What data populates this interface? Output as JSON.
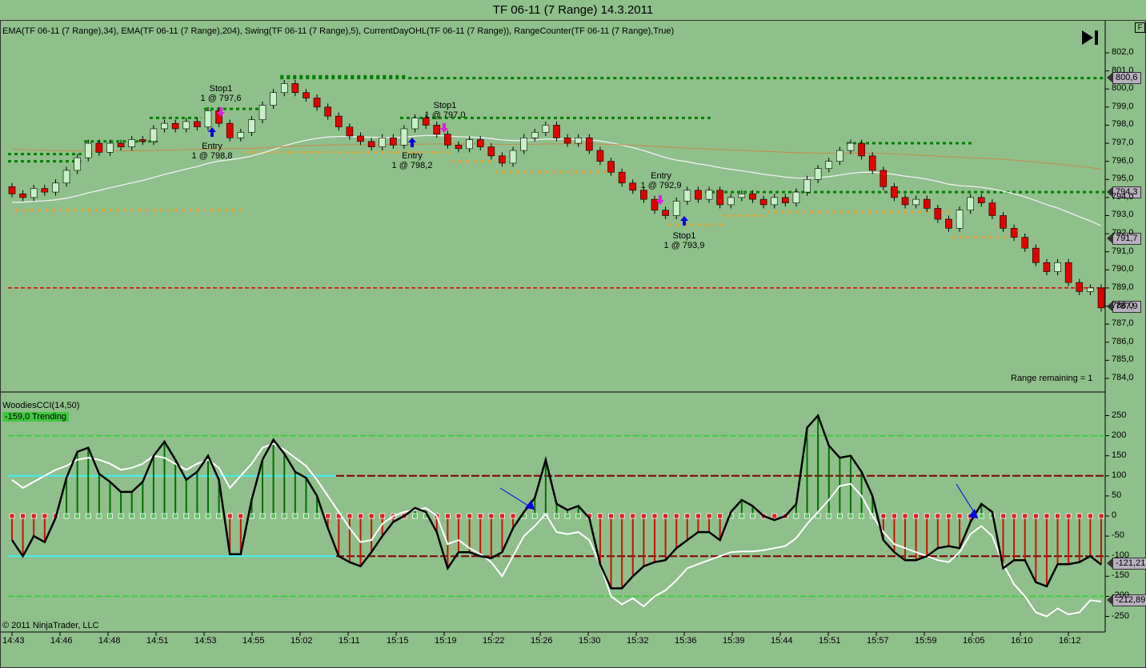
{
  "title": "TF 06-11 (7 Range)  14.3.2011",
  "indicators_label": "EMA(TF 06-11 (7 Range),34), EMA(TF 06-11 (7 Range),204), Swing(TF 06-11 (7 Range),5), CurrentDayOHL(TF 06-11 (7 Range)), RangeCounter(TF 06-11 (7 Range),True)",
  "f_button": "F",
  "range_remaining": "Range remaining = 1",
  "copyright": "© 2011 NinjaTrader, LLC",
  "cci_label": "WoodiesCCI(14,50)",
  "cci_status": "-159,0 Trending",
  "price_labels": {
    "ema204": "800,6",
    "swing": "794,3",
    "ema34": "791,7",
    "last": "787,9"
  },
  "cci_labels": {
    "cci": "-121,21",
    "turbo": "-212,89"
  },
  "annotations": [
    {
      "title": "Stop1",
      "text": "1 @ 797,6"
    },
    {
      "title": "Entry",
      "text": "1 @ 798,8"
    },
    {
      "title": "Stop1",
      "text": "1 @ 797,0"
    },
    {
      "title": "Entry",
      "text": "1 @ 798,2"
    },
    {
      "title": "Entry",
      "text": "1 @ 792,9"
    },
    {
      "title": "Stop1",
      "text": "1 @ 793,9"
    }
  ],
  "chart_data": {
    "type": "candlestick",
    "price_axis": {
      "min": 784,
      "max": 802,
      "step": 1,
      "ticks": [
        "802,0",
        "801,0",
        "800,0",
        "799,0",
        "798,0",
        "797,0",
        "796,0",
        "795,0",
        "794,0",
        "793,0",
        "792,0",
        "791,0",
        "790,0",
        "789,0",
        "788,0",
        "787,0",
        "786,0",
        "785,0",
        "784,0"
      ]
    },
    "time_ticks": [
      "14:43",
      "14:46",
      "14:48",
      "14:51",
      "14:53",
      "14:55",
      "15:02",
      "15:11",
      "15:15",
      "15:19",
      "15:22",
      "15:26",
      "15:30",
      "15:32",
      "15:36",
      "15:39",
      "15:44",
      "15:51",
      "15:57",
      "15:59",
      "16:05",
      "16:10",
      "16:12"
    ],
    "first_open": 794.6,
    "closes": [
      794.2,
      794.0,
      794.5,
      794.3,
      794.8,
      795.5,
      796.2,
      797.0,
      796.5,
      797.0,
      796.8,
      797.2,
      797.1,
      797.8,
      798.1,
      797.8,
      798.2,
      797.9,
      798.8,
      798.1,
      797.3,
      797.6,
      798.3,
      799.1,
      799.8,
      800.3,
      799.8,
      799.5,
      799.0,
      798.5,
      797.9,
      797.4,
      797.1,
      796.8,
      797.3,
      796.9,
      797.8,
      798.4,
      798.0,
      797.5,
      796.9,
      796.7,
      797.2,
      796.8,
      796.3,
      795.9,
      796.6,
      797.3,
      797.6,
      798.0,
      797.3,
      797.0,
      797.3,
      796.6,
      796.0,
      795.4,
      794.8,
      794.4,
      793.9,
      793.3,
      793.0,
      793.8,
      794.4,
      793.9,
      794.4,
      793.6,
      794.0,
      794.2,
      793.9,
      793.6,
      794.0,
      793.7,
      794.3,
      795.0,
      795.6,
      796.0,
      796.6,
      797.0,
      796.3,
      795.5,
      794.6,
      794.0,
      793.6,
      793.9,
      793.4,
      792.8,
      792.3,
      793.3,
      794.0,
      793.7,
      793.0,
      792.3,
      791.8,
      791.2,
      790.4,
      789.9,
      790.4,
      789.3,
      788.8,
      789.0,
      787.9
    ],
    "ema_periods": [
      34,
      204
    ],
    "current_day_low": 789.0,
    "swing_highs": [
      {
        "price": 796.4,
        "from": 0,
        "to": 7
      },
      {
        "price": 796.0,
        "from": 0,
        "to": 6
      },
      {
        "price": 797.1,
        "from": 7,
        "to": 13
      },
      {
        "price": 798.4,
        "from": 13,
        "to": 17
      },
      {
        "price": 798.9,
        "from": 18,
        "to": 23
      },
      {
        "price": 800.7,
        "from": 25,
        "to": 36
      },
      {
        "price": 800.6,
        "from": 25,
        "to": 100
      },
      {
        "price": 798.4,
        "from": 36,
        "to": 64
      },
      {
        "price": 797.0,
        "from": 77,
        "to": 88
      },
      {
        "price": 794.3,
        "from": 64,
        "to": 100
      }
    ],
    "swing_lows": [
      {
        "price": 793.3,
        "from": 0,
        "to": 21
      },
      {
        "price": 796.5,
        "from": 21,
        "to": 40
      },
      {
        "price": 796.0,
        "from": 40,
        "to": 44
      },
      {
        "price": 795.4,
        "from": 44,
        "to": 55
      },
      {
        "price": 792.5,
        "from": 60,
        "to": 65
      },
      {
        "price": 793.0,
        "from": 65,
        "to": 69
      },
      {
        "price": 793.2,
        "from": 69,
        "to": 86
      },
      {
        "price": 791.8,
        "from": 86,
        "to": 91
      }
    ],
    "cci_axis": {
      "min": -250,
      "max": 250,
      "ticks": [
        "250",
        "200",
        "150",
        "100",
        "50",
        "0",
        "-50",
        "-100",
        "-150",
        "-200",
        "-250"
      ]
    },
    "cci": [
      -60,
      -100,
      -50,
      -65,
      -5,
      95,
      160,
      170,
      105,
      85,
      60,
      60,
      85,
      150,
      185,
      140,
      90,
      110,
      150,
      90,
      -95,
      -95,
      40,
      140,
      190,
      155,
      110,
      95,
      50,
      -30,
      -100,
      -115,
      -125,
      -90,
      -50,
      -15,
      0,
      20,
      10,
      -40,
      -130,
      -90,
      -90,
      -100,
      -105,
      -90,
      -30,
      10,
      45,
      140,
      30,
      15,
      25,
      -5,
      -120,
      -180,
      -180,
      -150,
      -125,
      -115,
      -110,
      -80,
      -60,
      -40,
      -40,
      -60,
      10,
      40,
      25,
      0,
      -10,
      0,
      30,
      220,
      250,
      175,
      145,
      150,
      110,
      50,
      -60,
      -90,
      -110,
      -110,
      -100,
      -80,
      -75,
      -80,
      -15,
      30,
      10,
      -130,
      -110,
      -110,
      -165,
      -175,
      -120,
      -120,
      -115,
      -100,
      -121
    ],
    "turbo": [
      90,
      70,
      85,
      100,
      115,
      125,
      140,
      145,
      140,
      130,
      115,
      120,
      130,
      150,
      145,
      130,
      115,
      130,
      140,
      120,
      70,
      100,
      130,
      170,
      180,
      165,
      145,
      125,
      90,
      50,
      10,
      -30,
      -65,
      -60,
      -20,
      0,
      10,
      15,
      20,
      0,
      -70,
      -60,
      -80,
      -95,
      -115,
      -150,
      -100,
      -50,
      -25,
      5,
      -40,
      -45,
      -40,
      -60,
      -120,
      -200,
      -220,
      -205,
      -225,
      -200,
      -185,
      -160,
      -130,
      -120,
      -110,
      -100,
      -90,
      -88,
      -88,
      -85,
      -80,
      -75,
      -55,
      -20,
      10,
      40,
      75,
      80,
      50,
      0,
      -40,
      -70,
      -80,
      -90,
      -100,
      -110,
      -115,
      -90,
      -45,
      -25,
      -50,
      -120,
      -170,
      -200,
      -240,
      -250,
      -230,
      -245,
      -240,
      -210,
      -213
    ]
  },
  "colors": {
    "background": "#8fbf8b",
    "up_candle": "#c8f0c8",
    "down_candle": "#e00000",
    "ema34": "#f0f0f0",
    "ema204": "#d08040",
    "swing_high": "#008000",
    "swing_low": "#f0a020",
    "day_low": "#e00000",
    "cci_line": "#000000",
    "turbo_line": "#ffffff"
  }
}
